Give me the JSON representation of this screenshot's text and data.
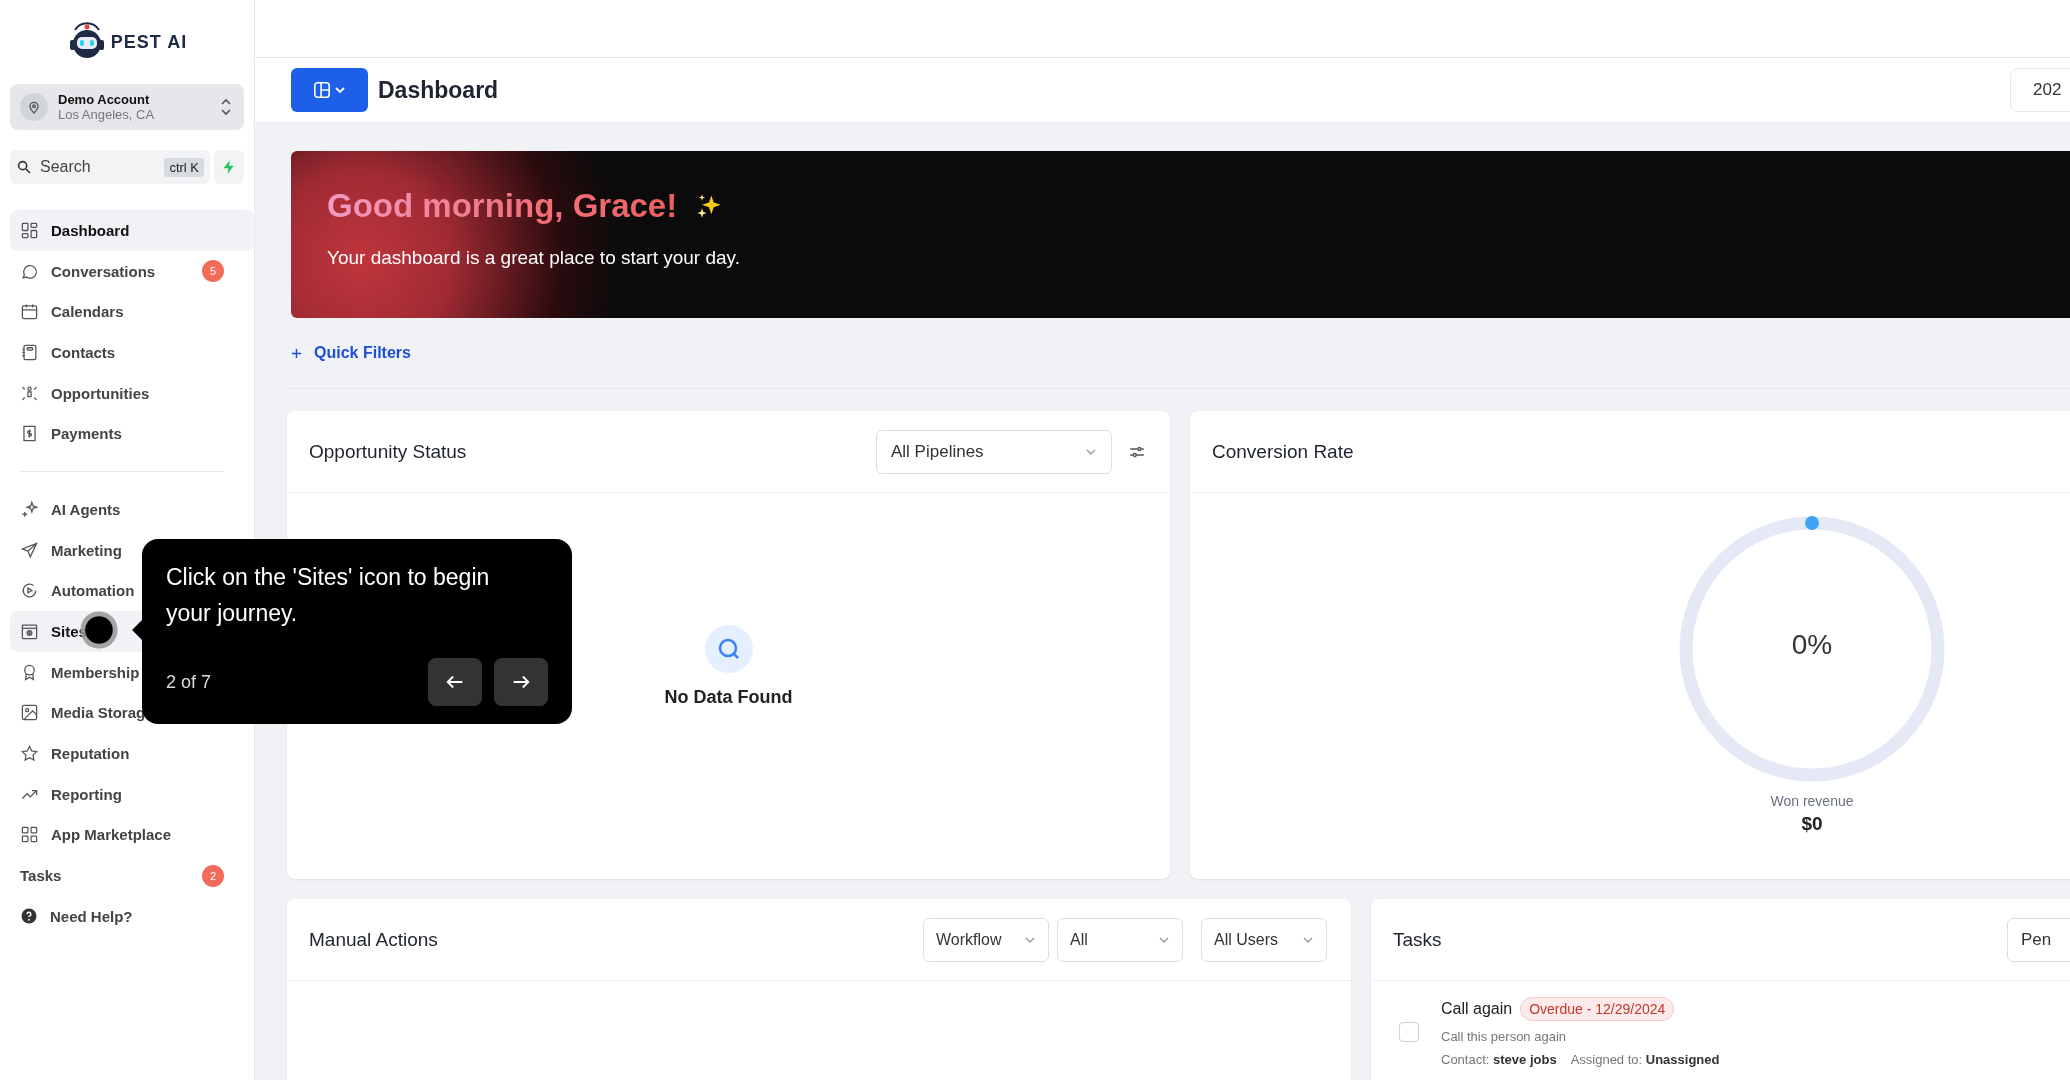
{
  "brand": {
    "name": "PEST AI"
  },
  "account": {
    "name": "Demo Account",
    "location": "Los Angeles, CA"
  },
  "search": {
    "placeholder": "Search",
    "shortcut": "ctrl K"
  },
  "nav_groups": [
    {
      "items": [
        {
          "label": "Dashboard",
          "selected": true
        },
        {
          "label": "Conversations",
          "selected": false,
          "badge": "5"
        },
        {
          "label": "Calendars",
          "selected": false
        },
        {
          "label": "Contacts",
          "selected": false
        },
        {
          "label": "Opportunities",
          "selected": false
        },
        {
          "label": "Payments",
          "selected": false
        }
      ]
    },
    {
      "items": [
        {
          "label": "AI Agents",
          "selected": false
        },
        {
          "label": "Marketing",
          "selected": false
        },
        {
          "label": "Automation",
          "selected": false
        },
        {
          "label": "Sites",
          "selected": true
        },
        {
          "label": "Membership",
          "selected": false
        },
        {
          "label": "Media Storag",
          "selected": false
        },
        {
          "label": "Reputation",
          "selected": false
        },
        {
          "label": "Reporting",
          "selected": false
        },
        {
          "label": "App Marketplace",
          "selected": false
        }
      ]
    }
  ],
  "tasks_link": {
    "label": "Tasks",
    "badge": "2"
  },
  "help_link": {
    "label": "Need Help?"
  },
  "header": {
    "title": "Dashboard",
    "date_button": "202"
  },
  "banner": {
    "greeting": "Good morning, Grace!",
    "subtitle": "Your dashboard is a great place to start your day."
  },
  "quick_filters": {
    "label": "Quick Filters"
  },
  "opportunity_status": {
    "title": "Opportunity Status",
    "pipeline": "All Pipelines",
    "empty_text": "No Data Found"
  },
  "conversion_rate": {
    "title": "Conversion Rate",
    "value": "0%",
    "caption": "Won revenue",
    "amount": "$0"
  },
  "manual_actions": {
    "title": "Manual Actions",
    "filters": [
      "Workflow",
      "All",
      "All Users"
    ]
  },
  "tasks": {
    "title": "Tasks",
    "filter": "Pen",
    "items": [
      {
        "title": "Call again",
        "badge": "Overdue - 12/29/2024",
        "description": "Call this person again",
        "contact": "Contact: **steve jobs**",
        "assigned": "Assigned to: **Unassigned**",
        "checked": false
      }
    ]
  },
  "tour": {
    "text": "Click on the 'Sites' icon to begin your journey.",
    "step": "2 of 7"
  }
}
